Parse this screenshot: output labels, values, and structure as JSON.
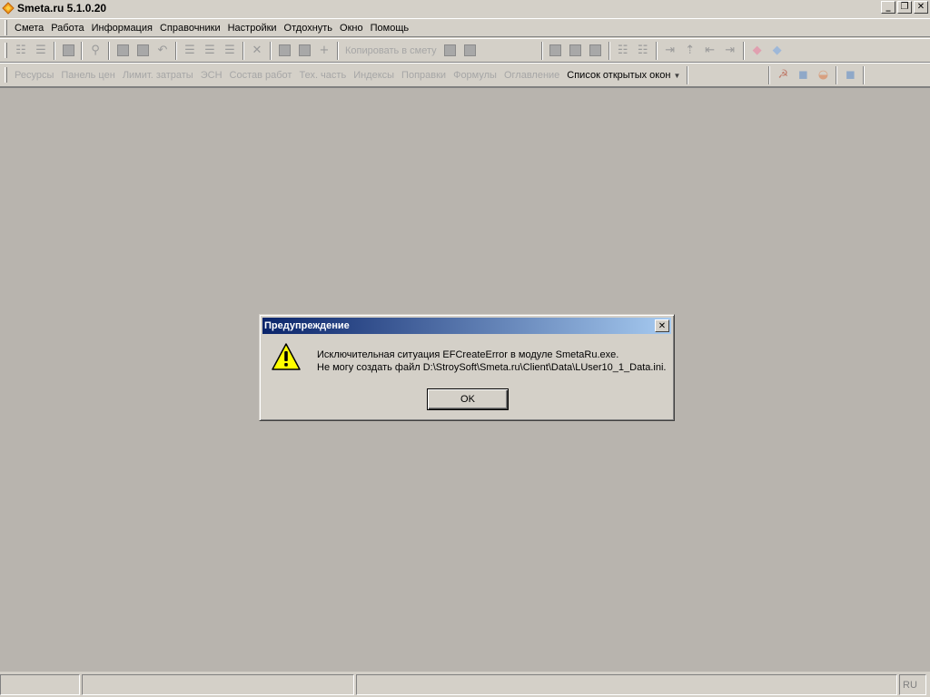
{
  "window": {
    "title": "Smeta.ru  5.1.0.20",
    "minimize": "_",
    "restore": "❐",
    "close": "✕"
  },
  "menu": {
    "items": [
      "Смета",
      "Работа",
      "Информация",
      "Справочники",
      "Настройки",
      "Отдохнуть",
      "Окно",
      "Помощь"
    ]
  },
  "toolbar1": {
    "copy_to_estimate": "Копировать в смету"
  },
  "toolbar2": {
    "tabs": [
      "Ресурсы",
      "Панель цен",
      "Лимит. затраты",
      "ЭСН",
      "Состав работ",
      "Тех. часть",
      "Индексы",
      "Поправки",
      "Формулы",
      "Оглавление"
    ],
    "open_windows": "Список открытых окон"
  },
  "statusbar": {
    "lang": "RU"
  },
  "dialog": {
    "title": "Предупреждение",
    "close": "✕",
    "line1": "Исключительная ситуация EFCreateError в модуле SmetaRu.exe.",
    "line2": "Не могу создать файл D:\\StroySoft\\Smeta.ru\\Client\\Data\\LUser10_1_Data.ini.",
    "ok": "OK"
  },
  "colors": {
    "face": "#d4d0c8",
    "workspace": "#b8b4ae",
    "title_gradient_start": "#0a246a",
    "title_gradient_end": "#a6caf0",
    "warning_yellow": "#ffff00"
  }
}
